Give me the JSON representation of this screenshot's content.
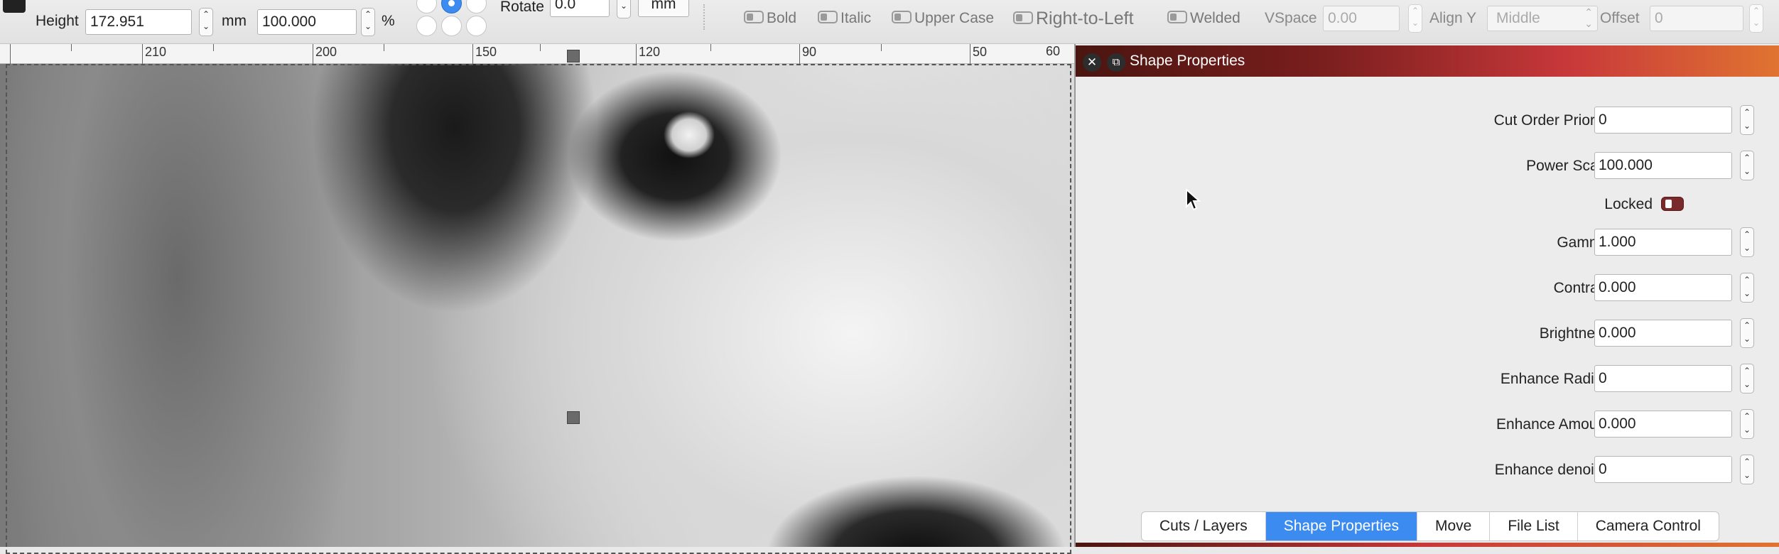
{
  "toolbar": {
    "height_label": "Height",
    "height_value": "172.951",
    "height_unit": "mm",
    "scale_value": "100.000",
    "scale_unit": "%",
    "rotate_label": "Rotate",
    "rotate_value": "0.0",
    "unit_button": "mm",
    "bold_label": "Bold",
    "italic_label": "Italic",
    "uppercase_label": "Upper Case",
    "rtl_label": "Right-to-Left",
    "welded_label": "Welded",
    "vspace_label": "VSpace",
    "vspace_value": "0.00",
    "aligny_label": "Align Y",
    "aligny_value": "Middle",
    "offset_label": "Offset",
    "offset_value": "0"
  },
  "ruler": {
    "labels": [
      "210",
      "200",
      "150",
      "120",
      "90",
      "50",
      "60"
    ]
  },
  "panel": {
    "title": "Shape Properties",
    "close_glyph": "✕",
    "restore_glyph": "⧉",
    "rows": [
      {
        "label": "Cut Order Priority",
        "value": "0"
      },
      {
        "label": "Power Scale",
        "value": "100.000"
      },
      {
        "label": "Locked",
        "value": ""
      },
      {
        "label": "Gamma",
        "value": "1.000"
      },
      {
        "label": "Contrast",
        "value": "0.000"
      },
      {
        "label": "Brightness",
        "value": "0.000"
      },
      {
        "label": "Enhance Radius",
        "value": "0"
      },
      {
        "label": "Enhance Amount",
        "value": "0.000"
      },
      {
        "label": "Enhance denoise",
        "value": "0"
      }
    ],
    "tabs": [
      "Cuts / Layers",
      "Shape Properties",
      "Move",
      "File List",
      "Camera Control"
    ],
    "active_tab": "Shape Properties"
  },
  "colors": {
    "accent": "#3b8bf0",
    "title_gradient_start": "#4a1510",
    "title_gradient_end": "#e07431",
    "toggle_on": "#7a2a2a"
  }
}
